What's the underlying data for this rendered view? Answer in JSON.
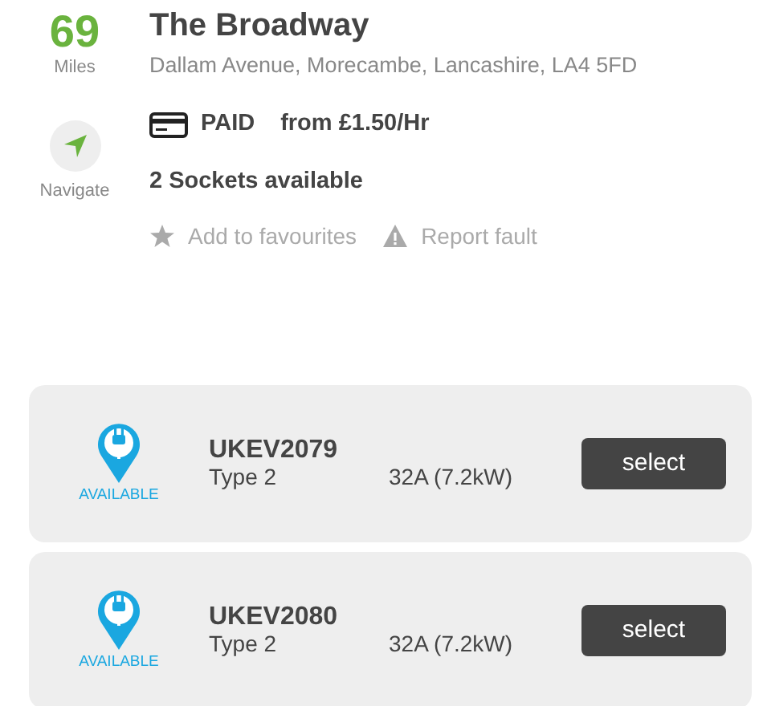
{
  "distance": {
    "value": "69",
    "unit": "Miles"
  },
  "navigate": {
    "label": "Navigate"
  },
  "location": {
    "title": "The Broadway",
    "address": "Dallam Avenue, Morecambe, Lancashire, LA4 5FD"
  },
  "payment": {
    "type": "PAID",
    "price": "from £1.50/Hr"
  },
  "sockets_summary": "2 Sockets available",
  "actions": [
    {
      "kind": "favourite",
      "label": "Add to favourites"
    },
    {
      "kind": "fault",
      "label": "Report fault"
    }
  ],
  "connectors": [
    {
      "status": "AVAILABLE",
      "id": "UKEV2079",
      "type": "Type 2",
      "power": "32A (7.2kW)",
      "button": "select"
    },
    {
      "status": "AVAILABLE",
      "id": "UKEV2080",
      "type": "Type 2",
      "power": "32A (7.2kW)",
      "button": "select"
    }
  ]
}
